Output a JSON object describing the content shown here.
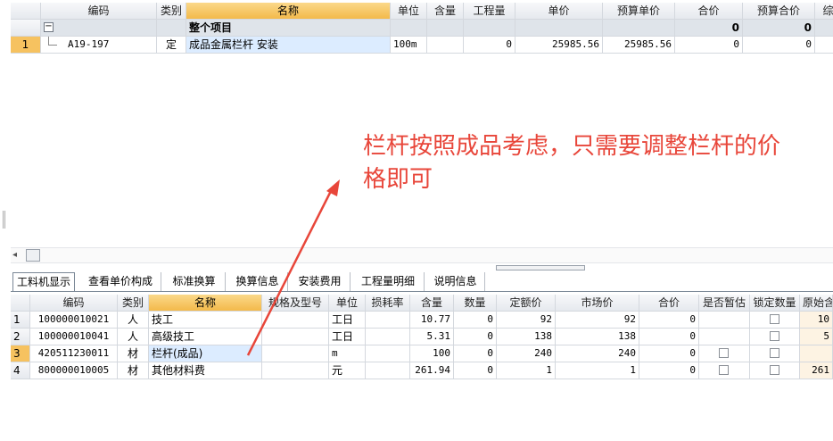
{
  "top_grid": {
    "headers": [
      "编码",
      "类别",
      "名称",
      "单位",
      "含量",
      "工程量",
      "单价",
      "预算单价",
      "合价",
      "预算合价",
      "综"
    ],
    "group_row": {
      "toggle": "−",
      "name": "整个项目",
      "total": "0",
      "budget_total": "0"
    },
    "rows": [
      {
        "num": "1",
        "code": "A19-197",
        "type": "定",
        "name": "成品金属栏杆 安装",
        "unit": "100m",
        "content": "",
        "quantity": "0",
        "unit_price": "25985.56",
        "budget_unit_price": "25985.56",
        "total": "0",
        "budget_total": "0"
      }
    ]
  },
  "annotation": {
    "line1": "栏杆按照成品考虑，只需要调整栏杆的价",
    "line2": "格即可",
    "color": "#e8463a"
  },
  "scroll": {
    "left_arrow": "◂"
  },
  "tabs": [
    "工料机显示",
    "查看单价构成",
    "标准换算",
    "换算信息",
    "安装费用",
    "工程量明细",
    "说明信息"
  ],
  "bottom_grid": {
    "headers": [
      "编码",
      "类别",
      "名称",
      "规格及型号",
      "单位",
      "损耗率",
      "含量",
      "数量",
      "定额价",
      "市场价",
      "合价",
      "是否暂估",
      "锁定数量",
      "原始含"
    ],
    "rows": [
      {
        "num": "1",
        "code": "100000010021",
        "type": "人",
        "name": "技工",
        "spec": "",
        "unit": "工日",
        "loss": "",
        "content": "10.77",
        "qty": "0",
        "quota_price": "92",
        "market_price": "92",
        "total": "0",
        "has_est": false,
        "orig": "10"
      },
      {
        "num": "2",
        "code": "100000010041",
        "type": "人",
        "name": "高级技工",
        "spec": "",
        "unit": "工日",
        "loss": "",
        "content": "5.31",
        "qty": "0",
        "quota_price": "138",
        "market_price": "138",
        "total": "0",
        "has_est": false,
        "orig": "5"
      },
      {
        "num": "3",
        "code": "420511230011",
        "type": "材",
        "name": "栏杆(成品)",
        "spec": "",
        "unit": "m",
        "loss": "",
        "content": "100",
        "qty": "0",
        "quota_price": "240",
        "market_price": "240",
        "total": "0",
        "has_est": true,
        "orig": ""
      },
      {
        "num": "4",
        "code": "800000010005",
        "type": "材",
        "name": "其他材料费",
        "spec": "",
        "unit": "元",
        "loss": "",
        "content": "261.94",
        "qty": "0",
        "quota_price": "1",
        "market_price": "1",
        "total": "0",
        "has_est": true,
        "orig": "261"
      }
    ]
  }
}
